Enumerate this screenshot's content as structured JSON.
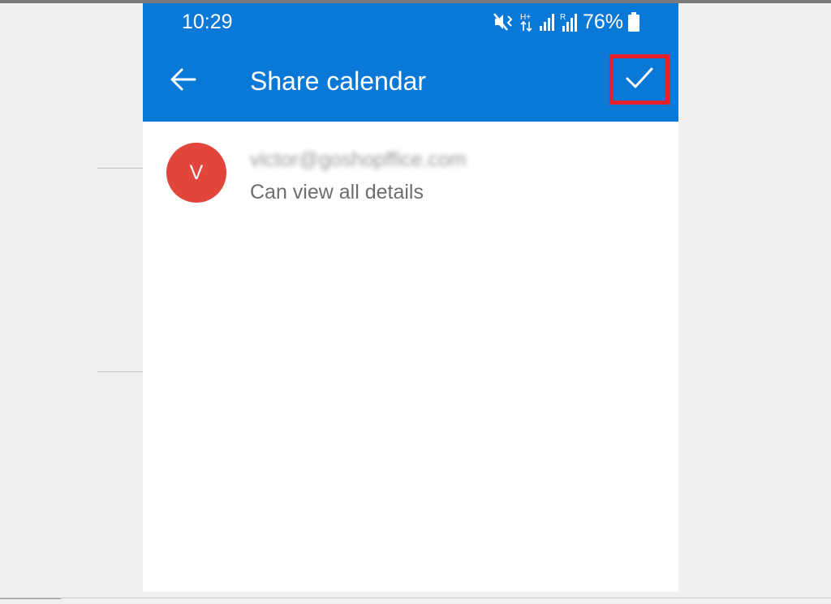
{
  "status_bar": {
    "time": "10:29",
    "battery_percent": "76%",
    "icons": [
      "mute-vibrate-icon",
      "data-transfer-icon",
      "signal-icon",
      "signal-roaming-icon",
      "battery-icon"
    ]
  },
  "toolbar": {
    "title": "Share calendar",
    "back_icon": "arrow-left-icon",
    "confirm_icon": "checkmark-icon"
  },
  "share_list": [
    {
      "avatar_initial": "V",
      "email": "victor@goshopffice.com",
      "permission": "Can view all details"
    }
  ],
  "colors": {
    "header": "#0a78d7",
    "avatar": "#e1453b",
    "highlight_box": "#e8202a",
    "background": "#f0f0f0"
  }
}
